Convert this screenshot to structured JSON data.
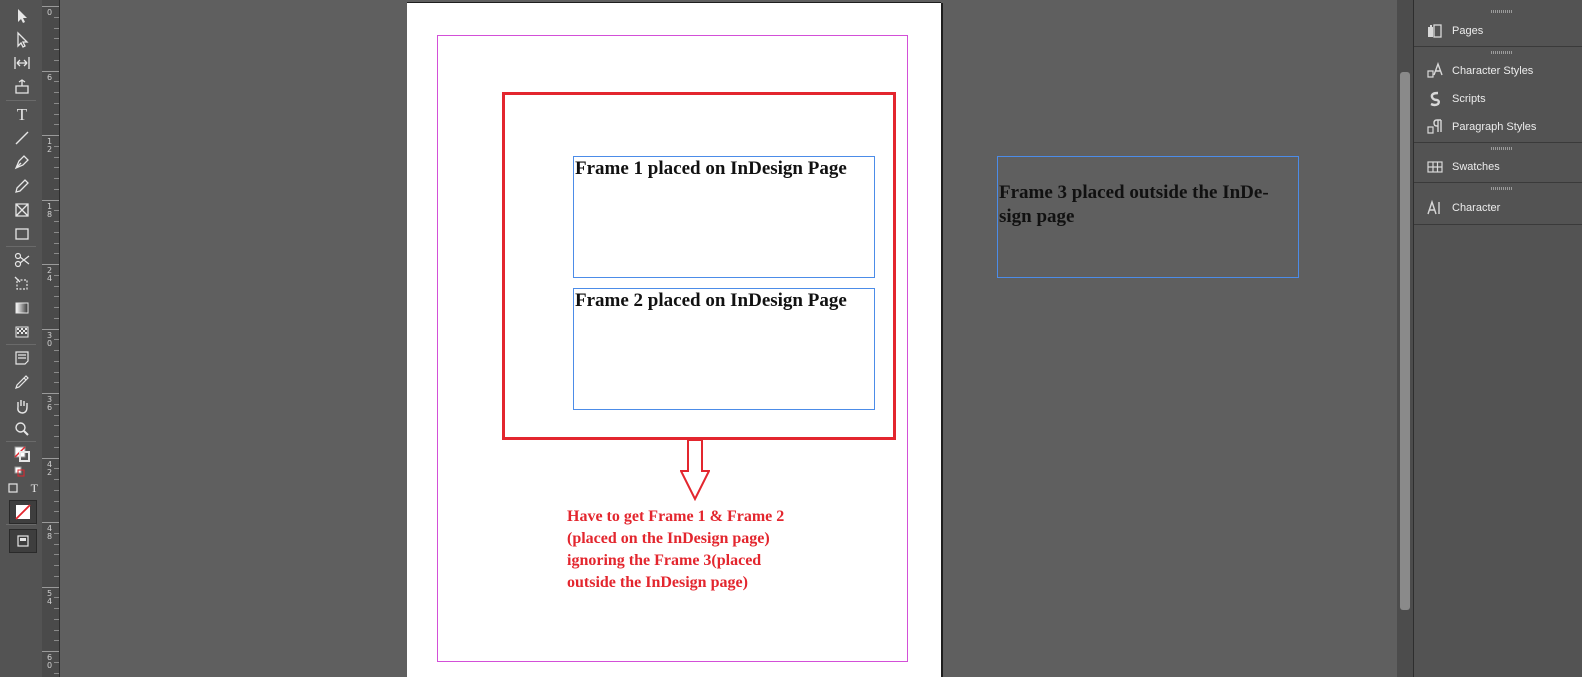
{
  "document": {
    "frames": [
      {
        "text": "Frame 1 placed on InDesign Page"
      },
      {
        "text": "Frame 2 placed on InDesign Page"
      },
      {
        "text": "Frame 3 placed outside the  InDe-\nsign page"
      }
    ],
    "annotation": "Have to get Frame 1 & Frame 2\n(placed on the InDesign page)\nignoring the Frame 3(placed\noutside the InDesign page)"
  },
  "ruler": {
    "labels": [
      "0",
      "6",
      "1 2",
      "1 8",
      "2 4",
      "3 0",
      "3 6",
      "4 2",
      "4 8",
      "5 4",
      "6 0"
    ]
  },
  "toolbar": {
    "type_tool_glyph": "T",
    "formatting_text_glyph": "T"
  },
  "panels": {
    "items": [
      {
        "label": "Pages",
        "icon": "pages-icon"
      },
      {
        "label": "Character Styles",
        "icon": "character-styles-icon"
      },
      {
        "label": "Scripts",
        "icon": "scripts-icon"
      },
      {
        "label": "Paragraph Styles",
        "icon": "paragraph-styles-icon"
      },
      {
        "label": "Swatches",
        "icon": "swatches-icon"
      },
      {
        "label": "Character",
        "icon": "character-icon"
      }
    ]
  },
  "colors": {
    "annotation": "#e3262e",
    "frame_border": "#4c8ce8",
    "margin_guide": "#d34fd8",
    "pasteboard": "#5f5f5f"
  }
}
